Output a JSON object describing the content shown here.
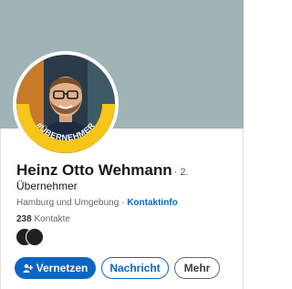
{
  "profile": {
    "name": "Heinz Otto Wehmann",
    "degree": "· 2.",
    "headline": "Übernehmer",
    "location": "Hamburg und Umgebung",
    "location_separator": " · ",
    "contact_info": "Kontaktinfo",
    "connections_count": "238",
    "connections_label": "Kontakte",
    "avatar_badge_text": "#ÜBERNEHMER"
  },
  "actions": {
    "connect_label": "Vernetzen",
    "message_label": "Nachricht",
    "more_label": "Mehr"
  },
  "colors": {
    "banner": "#a0b4b7",
    "accent": "#0a66c2",
    "badge": "#f5c518"
  },
  "icons": {
    "connect": "add-person-icon"
  }
}
